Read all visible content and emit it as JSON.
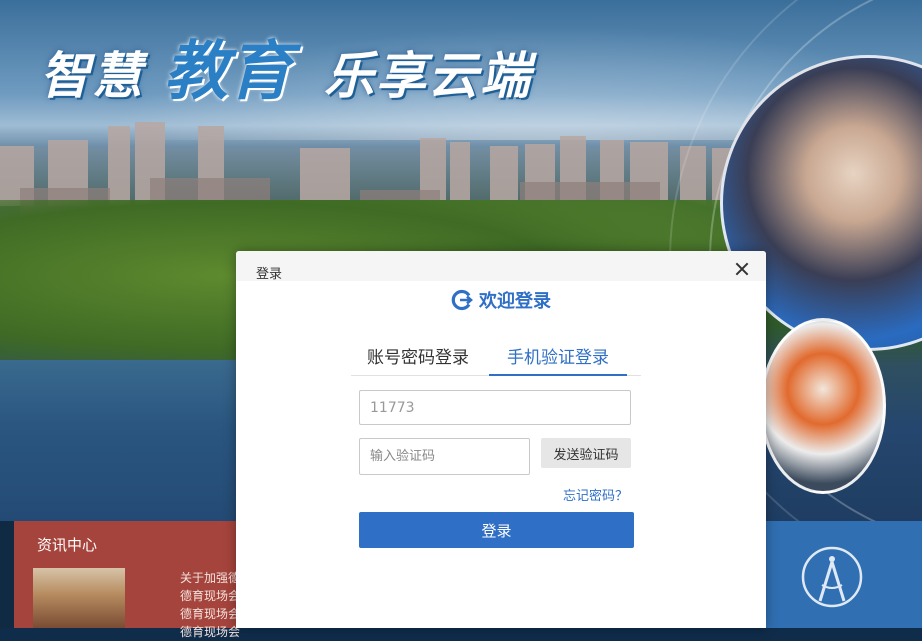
{
  "banner": {
    "slogan": {
      "part1": "智慧",
      "part2": "教育",
      "part3": "乐享云端"
    }
  },
  "news": {
    "title": "资讯中心",
    "items": [
      "关于加强德",
      "德育现场会",
      "德育现场会",
      "德育现场会"
    ]
  },
  "modal": {
    "title": "登录",
    "welcome": "欢迎登录",
    "tabs": {
      "account": "账号密码登录",
      "phone": "手机验证登录"
    },
    "phone_value": "11773",
    "code_placeholder": "输入验证码",
    "send_code": "发送验证码",
    "forgot": "忘记密码？",
    "login": "登录"
  },
  "colors": {
    "accent": "#2f6fc6",
    "news_bg": "#a5443c",
    "right_block": "#2f6fb2"
  },
  "icons": {
    "welcome": "login-logo-icon",
    "close": "close-icon",
    "compass": "compass-logo-icon"
  }
}
